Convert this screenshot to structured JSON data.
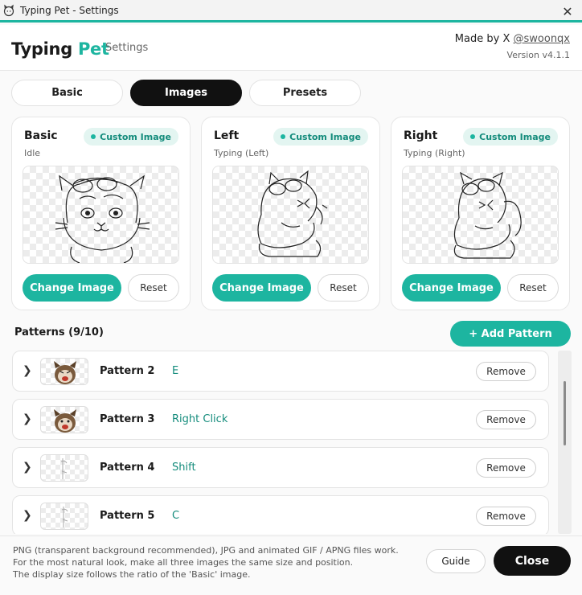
{
  "window": {
    "title": "Typing Pet - Settings",
    "close_glyph": "✕"
  },
  "header": {
    "brand_main": "Typing",
    "brand_accent": "Pet",
    "subtitle": "Settings",
    "made_by_prefix": "Made by X",
    "made_by_handle": "@swoonqx",
    "version": "Version v4.1.1"
  },
  "tabs": [
    {
      "label": "Basic",
      "active": false
    },
    {
      "label": "Images",
      "active": true
    },
    {
      "label": "Presets",
      "active": false
    }
  ],
  "cards": [
    {
      "title": "Basic",
      "subtitle": "Idle",
      "badge": "Custom Image",
      "primary": "Change Image",
      "reset": "Reset"
    },
    {
      "title": "Left",
      "subtitle": "Typing (Left)",
      "badge": "Custom Image",
      "primary": "Change Image",
      "reset": "Reset"
    },
    {
      "title": "Right",
      "subtitle": "Typing (Right)",
      "badge": "Custom Image",
      "primary": "Change Image",
      "reset": "Reset"
    }
  ],
  "patterns": {
    "title": "Patterns (9/10)",
    "add_label": "+ Add Pattern",
    "items": [
      {
        "name": "Pattern 2",
        "key": "E",
        "remove": "Remove"
      },
      {
        "name": "Pattern 3",
        "key": "Right Click",
        "remove": "Remove"
      },
      {
        "name": "Pattern 4",
        "key": "Shift",
        "remove": "Remove"
      },
      {
        "name": "Pattern 5",
        "key": "C",
        "remove": "Remove"
      }
    ]
  },
  "footer": {
    "notes": [
      "PNG (transparent background recommended), JPG and animated GIF / APNG files work.",
      "For the most natural look, make all three images the same size and position.",
      "The display size follows the ratio of the 'Basic' image."
    ],
    "guide_label": "Guide",
    "close_label": "Close"
  },
  "colors": {
    "accent": "#1db5a0",
    "dark": "#111111",
    "badge_bg": "#e3f5f1"
  },
  "icons": [
    "cat-app-icon",
    "close-icon",
    "chevron-right-icon"
  ]
}
